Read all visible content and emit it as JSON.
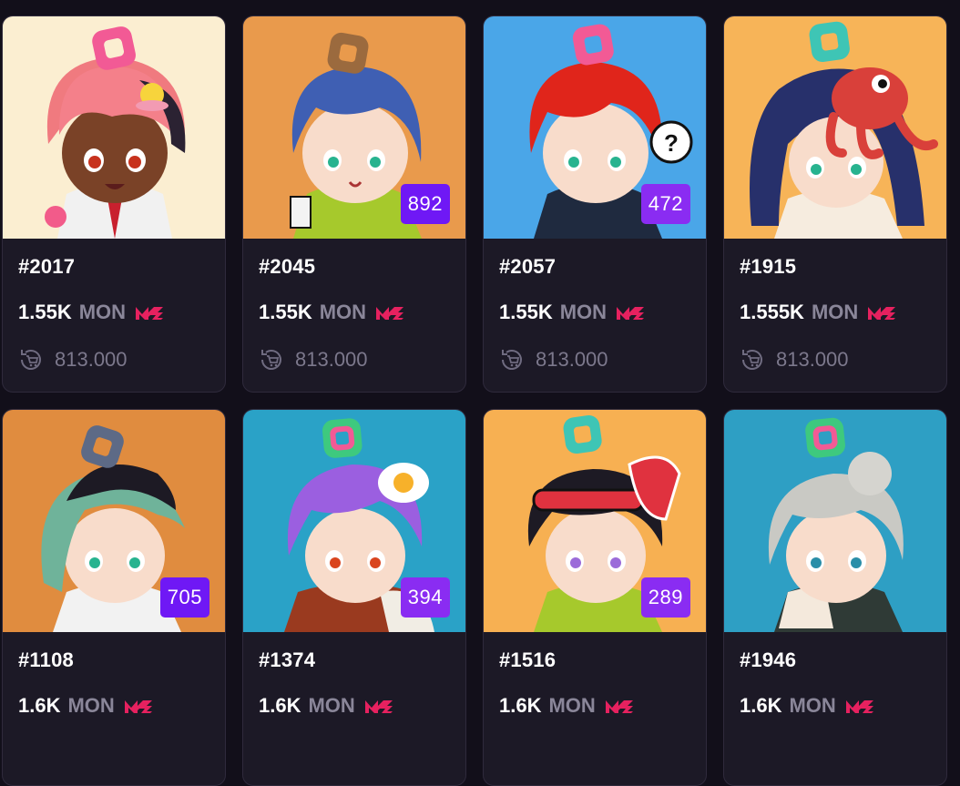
{
  "colors": {
    "page_background": "#120f1a",
    "card_background": "#1c1926",
    "rank_badge": "#6f18f5",
    "currency_text": "#8a8699",
    "me_logo": "#e6215f"
  },
  "icons": {
    "marketplace_logo": "magic-eden-icon",
    "offer": "cart-refresh-icon"
  },
  "cards": [
    {
      "name": "#2017",
      "price": "1.55K",
      "currency": "MON",
      "offer": "813.000",
      "rank": null,
      "bg": "#fbeed1"
    },
    {
      "name": "#2045",
      "price": "1.55K",
      "currency": "MON",
      "offer": "813.000",
      "rank": "892",
      "bg": "#e99a4c"
    },
    {
      "name": "#2057",
      "price": "1.55K",
      "currency": "MON",
      "offer": "813.000",
      "rank": "472",
      "bg": "#4aa6e8"
    },
    {
      "name": "#1915",
      "price": "1.555K",
      "currency": "MON",
      "offer": "813.000",
      "rank": null,
      "bg": "#f7b458"
    },
    {
      "name": "#1108",
      "price": "1.6K",
      "currency": "MON",
      "offer": "",
      "rank": "705",
      "bg": "#e08c3f"
    },
    {
      "name": "#1374",
      "price": "1.6K",
      "currency": "MON",
      "offer": "",
      "rank": "394",
      "bg": "#2aa2c7"
    },
    {
      "name": "#1516",
      "price": "1.6K",
      "currency": "MON",
      "offer": "",
      "rank": "289",
      "bg": "#f7b052"
    },
    {
      "name": "#1946",
      "price": "1.6K",
      "currency": "MON",
      "offer": "",
      "rank": null,
      "bg": "#2e9fc4"
    }
  ]
}
